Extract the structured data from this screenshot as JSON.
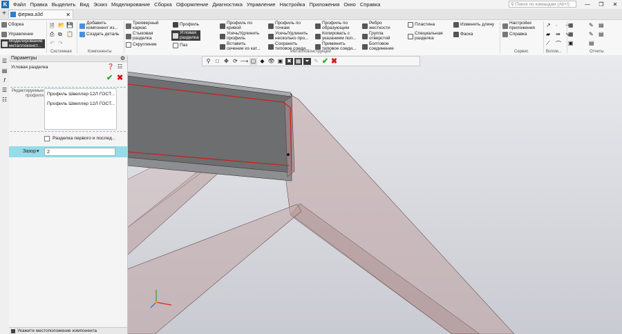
{
  "menu": {
    "items": [
      "Файл",
      "Правка",
      "Выделить",
      "Вид",
      "Эскиз",
      "Моделирование",
      "Сборка",
      "Оформление",
      "Диагностика",
      "Управление",
      "Настройка",
      "Приложения",
      "Окно",
      "Справка"
    ],
    "search_placeholder": "Поиск по командам (Alt+/)"
  },
  "tab": {
    "title": "ферма.a3d"
  },
  "ribbon": {
    "left_modes": [
      "Сборка",
      "Управление",
      "Моделирование\nметаллоконст..."
    ],
    "system_label": "Системная",
    "components": {
      "add": "Добавить\nкомпонент из...",
      "create": "Создать деталь",
      "label": "Компоненты"
    },
    "metal": {
      "col1": [
        "Трехмерный\nкаркас",
        "Стыковая\nразделка",
        "Скругление"
      ],
      "col2": [
        "Профиль",
        "Угловая\nразделка",
        "Паз"
      ],
      "col3": [
        "Профиль по\nкривой",
        "Усечь/Удлинить\nпрофиль",
        "Вставить\nсечение из кат..."
      ],
      "col4": [
        "Профиль по\nточкам",
        "Усечь/Удлинить\nнесколько про...",
        "Сохранить\nтиповое соеди..."
      ],
      "col5": [
        "Профиль по\nобразующим",
        "Копировать с\nуказанием пол...",
        "Применить\nтиповое соеди..."
      ],
      "col6": [
        "Ребро\nжесткости",
        "Группа\nотверстий",
        "Болтовое\nсоединение"
      ],
      "col7": [
        "Пластина",
        "Специальная\nразделка"
      ],
      "col8": [
        "Изменить длину",
        "Фаска"
      ],
      "label": "Металлоконструкции"
    },
    "service": {
      "settings": "Настройки\nприложения",
      "help": "Справка",
      "label": "Сервис"
    },
    "aux_label": "Вспом...",
    "reports_label": "Отчеты"
  },
  "params": {
    "header": "Параметры",
    "command_title": "Угловая разделка",
    "editable_label": "Редактируемые\nпрофили",
    "profiles": [
      "Профиль Швеллер  12Л ГОСТ...",
      "Профиль Швеллер  12Л ГОСТ..."
    ],
    "checkbox_label": "Разделка первого и послед...",
    "checkbox_checked": false,
    "gap_label": "Зазор",
    "gap_value": "2"
  },
  "status": {
    "text": "Укажите местоположение компонента"
  },
  "colors": {
    "accent": "#96dbe8",
    "active_tool": "#3b3b3b",
    "ok": "#2aa52a",
    "cancel": "#dd1111",
    "model_fill": "#b79a9a"
  }
}
